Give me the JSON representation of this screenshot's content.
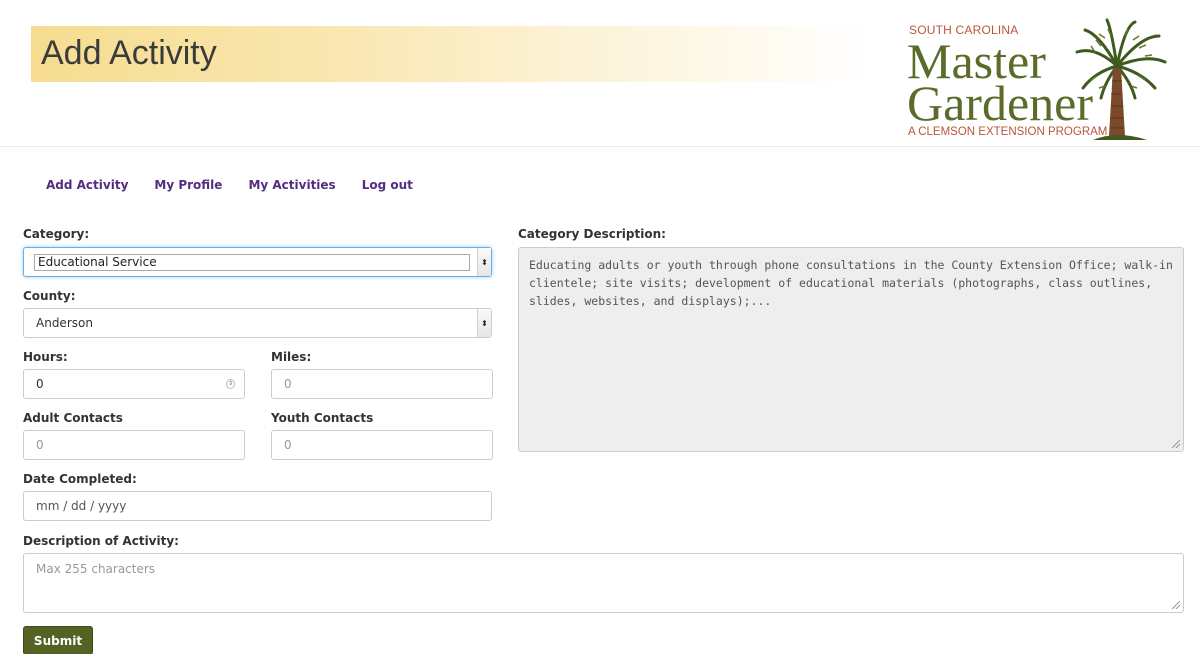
{
  "header": {
    "title": "Add Activity"
  },
  "logo": {
    "line1": "SOUTH CAROLINA",
    "line2": "Master",
    "line3": "Gardener",
    "line4": "A CLEMSON EXTENSION PROGRAM"
  },
  "nav": {
    "items": [
      {
        "label": "Add Activity"
      },
      {
        "label": "My Profile"
      },
      {
        "label": "My Activities"
      },
      {
        "label": "Log out"
      }
    ]
  },
  "form": {
    "category": {
      "label": "Category:",
      "value": "Educational Service"
    },
    "county": {
      "label": "County:",
      "value": "Anderson"
    },
    "hours": {
      "label": "Hours:",
      "value": "0"
    },
    "miles": {
      "label": "Miles:",
      "placeholder": "0"
    },
    "adult_contacts": {
      "label": "Adult Contacts",
      "placeholder": "0"
    },
    "youth_contacts": {
      "label": "Youth Contacts",
      "placeholder": "0"
    },
    "date_completed": {
      "label": "Date Completed:",
      "placeholder": "mm / dd / yyyy"
    },
    "description_of_activity": {
      "label": "Description of Activity:",
      "placeholder": "Max 255 characters"
    },
    "category_description": {
      "label": "Category Description:",
      "value": "Educating adults or youth through phone consultations in the County Extension Office; walk-in clientele; site visits; development of educational materials (photographs, class outlines, slides, websites, and displays);..."
    },
    "submit_label": "Submit"
  },
  "colors": {
    "nav_link": "#522d80",
    "submit_bg": "#546223",
    "logo_green": "#5a6b2a",
    "logo_orange": "#b8553a",
    "banner_gold": "#f5dc8f"
  }
}
